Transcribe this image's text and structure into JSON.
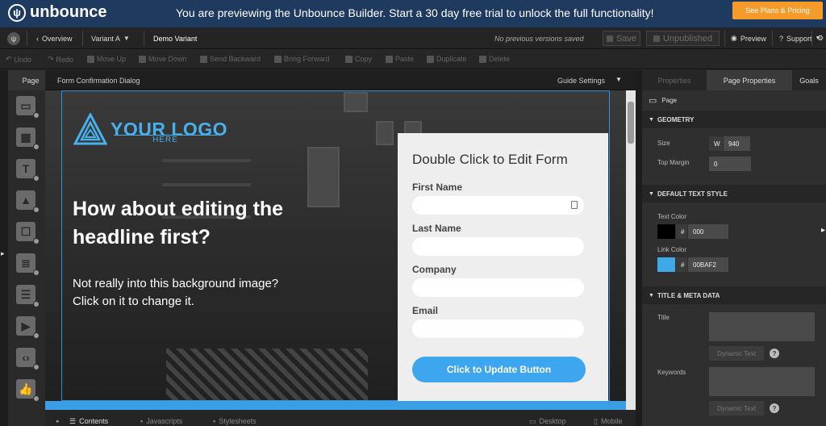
{
  "banner": {
    "logo": "unbounce",
    "text": "You are previewing the Unbounce Builder. Start a 30 day free trial to unlock the full functionality!",
    "cta": "See Plans & Pricing"
  },
  "topbar": {
    "overview": "Overview",
    "variant": "Variant A",
    "variant_name": "Demo Variant",
    "status": "No previous versions saved",
    "save": "Save",
    "unpublished": "Unpublished",
    "preview": "Preview",
    "support": "Support"
  },
  "toolbar": {
    "undo": "Undo",
    "redo": "Redo",
    "move_up": "Move Up",
    "move_down": "Move Down",
    "send_backward": "Send Backward",
    "bring_forward": "Bring Forward",
    "copy": "Copy",
    "paste": "Paste",
    "duplicate": "Duplicate",
    "delete": "Delete"
  },
  "left": {
    "page_tab": "Page"
  },
  "canvas": {
    "title": "Form Confirmation Dialog",
    "guide": "Guide Settings",
    "logo_text": "YOUR LOGO",
    "logo_sub": "HERE",
    "headline": "How about editing the headline first?",
    "subtext": "Not really into this background image? Click on it to change it.",
    "form": {
      "title": "Double Click to Edit Form",
      "fields": [
        "First Name",
        "Last Name",
        "Company",
        "Email"
      ],
      "button": "Click to Update Button"
    }
  },
  "bottom": {
    "contents": "Contents",
    "javascripts": "Javascripts",
    "stylesheets": "Stylesheets",
    "desktop": "Desktop",
    "mobile": "Mobile"
  },
  "right": {
    "tabs": [
      "Properties",
      "Page Properties",
      "Goals"
    ],
    "page_label": "Page",
    "geometry": {
      "title": "GEOMETRY",
      "size": "Size",
      "w": "W",
      "width_value": "940",
      "top_margin": "Top Margin",
      "top_margin_value": "0"
    },
    "text_style": {
      "title": "DEFAULT TEXT STYLE",
      "text_color": "Text Color",
      "text_color_value": "000",
      "link_color": "Link Color",
      "link_color_value": "00BAF2"
    },
    "meta": {
      "title": "TITLE & META DATA",
      "title_label": "Title",
      "keywords": "Keywords",
      "dynamic_text": "Dynamic Text"
    }
  },
  "colors": {
    "accent": "#3ea6ee",
    "banner": "#1e3a5f",
    "orange": "#f49b2a",
    "text_color": "#000000",
    "link_color": "#3fa9e8"
  }
}
